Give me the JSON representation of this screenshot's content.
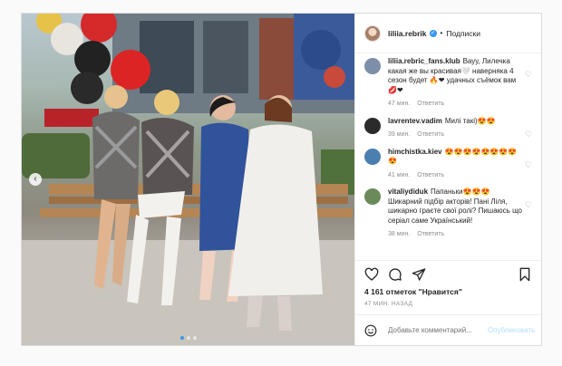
{
  "post": {
    "username": "liliia.rebrik",
    "separator": "•",
    "follow_label": "Подписки",
    "likes_text": "4 161 отметок \"Нравится\"",
    "time_ago": "47 МИН. НАЗАД",
    "comment_placeholder": "Добавьте комментарий...",
    "publish_label": "Опубликовать",
    "carousel": {
      "slides": 3,
      "active_index": 0
    }
  },
  "comments": [
    {
      "user": "liliia.rebric_fans.klub",
      "text": "Вауу, Лилечка какая же вы красивая🤍 наверняка 4 сезон будет 🔥❤ удачных съёмок вам 💋❤",
      "time": "47 мин.",
      "reply": "Ответить",
      "avatar_color": "#7d8fa8"
    },
    {
      "user": "lavrentev.vadim",
      "text": "Милі такі)😍😍",
      "time": "39 мин.",
      "reply": "Ответить",
      "avatar_color": "#2b2b2b"
    },
    {
      "user": "himchistka.kiev",
      "text": "😍😍😍😍😍😍😍😍😍",
      "time": "41 мин.",
      "reply": "Ответить",
      "avatar_color": "#4a7fb0"
    },
    {
      "user": "vitaliydiduk",
      "text": "Папаньки😍😍😍 Шикарний підбір акторів! Пані Ліля, шикарно граєте свої ролі? Пишаюсь що серіал саме Український!",
      "time": "38 мин.",
      "reply": "Ответить",
      "avatar_color": "#6b8a5a"
    }
  ],
  "icons": {
    "heart": "heart-icon",
    "comment": "comment-icon",
    "share": "share-icon",
    "bookmark": "bookmark-icon",
    "emoji": "emoji-icon",
    "verified": "verified-badge-icon",
    "prev": "chevron-left-icon"
  },
  "colors": {
    "accent": "#3897f0",
    "muted": "#8e8e8e",
    "border": "#dbdbdb"
  }
}
